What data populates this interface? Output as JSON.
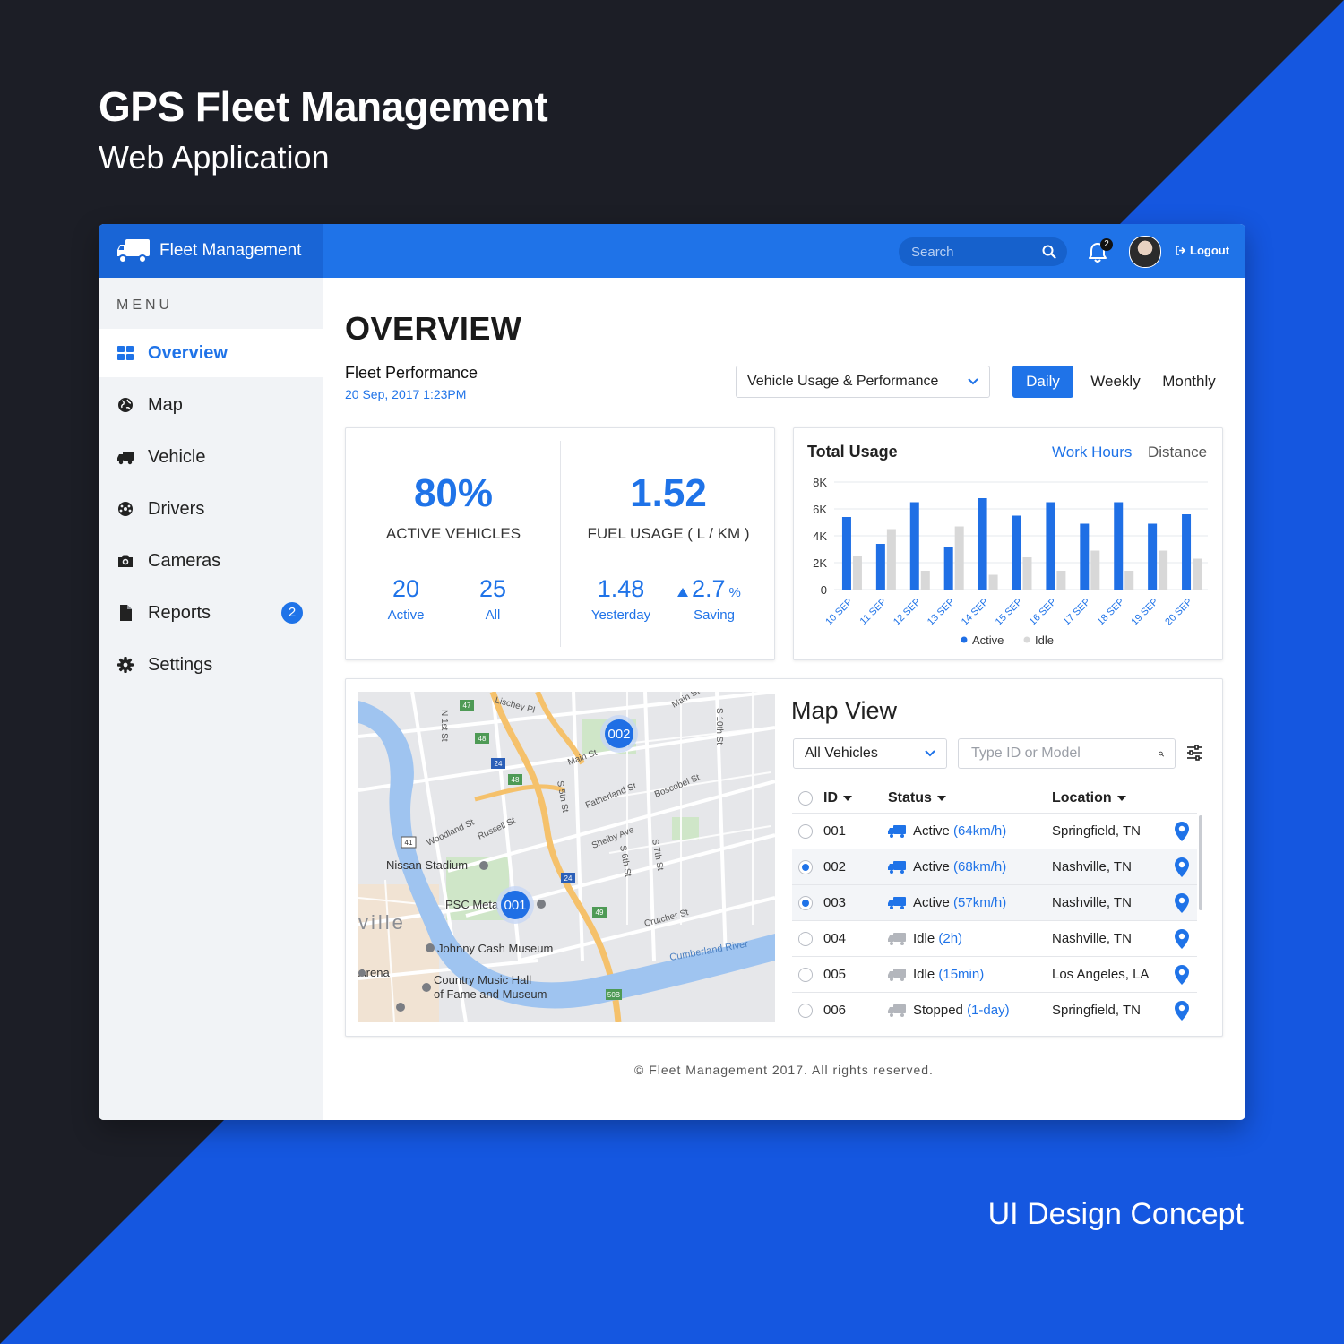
{
  "hero": {
    "title": "GPS Fleet Management",
    "subtitle": "Web Application",
    "tagline": "UI Design Concept"
  },
  "header": {
    "app_name": "Fleet Management",
    "search_placeholder": "Search",
    "notifications_count": "2",
    "logout_label": "Logout"
  },
  "sidebar": {
    "menu_label": "MENU",
    "items": [
      {
        "label": "Overview",
        "icon": "grid-icon",
        "active": true
      },
      {
        "label": "Map",
        "icon": "globe-icon"
      },
      {
        "label": "Vehicle",
        "icon": "truck-icon"
      },
      {
        "label": "Drivers",
        "icon": "steering-wheel-icon"
      },
      {
        "label": "Cameras",
        "icon": "camera-icon"
      },
      {
        "label": "Reports",
        "icon": "document-icon",
        "badge": "2"
      },
      {
        "label": "Settings",
        "icon": "gear-icon"
      }
    ]
  },
  "overview": {
    "title": "OVERVIEW",
    "section_title": "Fleet Performance",
    "section_date": "20 Sep, 2017  1:23PM",
    "dropdown_value": "Vehicle Usage & Performance",
    "periods": [
      "Daily",
      "Weekly",
      "Monthly"
    ],
    "active_period": "Daily"
  },
  "kpis": {
    "active_vehicles": {
      "value": "80%",
      "caption": "ACTIVE VEHICLES",
      "a_value": "20",
      "a_label": "Active",
      "b_value": "25",
      "b_label": "All"
    },
    "fuel_usage": {
      "value": "1.52",
      "caption": "FUEL USAGE ( L / KM )",
      "a_value": "1.48",
      "a_label": "Yesterday",
      "b_value": "2.7",
      "b_unit": "%",
      "b_label": "Saving"
    }
  },
  "usage_chart": {
    "title": "Total Usage",
    "tabs": [
      "Work Hours",
      "Distance"
    ],
    "active_tab": "Work Hours"
  },
  "chart_data": {
    "type": "bar",
    "title": "Total Usage",
    "categories": [
      "10 SEP",
      "11 SEP",
      "12 SEP",
      "13 SEP",
      "14 SEP",
      "15 SEP",
      "16 SEP",
      "17 SEP",
      "18 SEP",
      "19 SEP",
      "20 SEP"
    ],
    "series": [
      {
        "name": "Active",
        "color": "#1f6fe5",
        "values": [
          5400,
          3400,
          6500,
          3200,
          6800,
          5500,
          6500,
          4900,
          6500,
          4900,
          5600
        ]
      },
      {
        "name": "Idle",
        "color": "#d8d8d8",
        "values": [
          2500,
          4500,
          1400,
          4700,
          1100,
          2400,
          1400,
          2900,
          1400,
          2900,
          2300
        ]
      }
    ],
    "yticks": [
      "8K",
      "6K",
      "4K",
      "2K",
      "0"
    ],
    "ylim": [
      0,
      8000
    ],
    "grid": true,
    "legend_position": "bottom"
  },
  "map_view": {
    "title": "Map View",
    "filter_value": "All Vehicles",
    "search_placeholder": "Type ID or Model",
    "columns": [
      "ID",
      "Status",
      "Location"
    ],
    "rows": [
      {
        "id": "001",
        "status": "Active",
        "detail": "(64km/h)",
        "location": "Springfield, TN",
        "selected": false,
        "kind": "active"
      },
      {
        "id": "002",
        "status": "Active",
        "detail": "(68km/h)",
        "location": "Nashville, TN",
        "selected": true,
        "kind": "active"
      },
      {
        "id": "003",
        "status": "Active",
        "detail": "(57km/h)",
        "location": "Nashville, TN",
        "selected": true,
        "kind": "active"
      },
      {
        "id": "004",
        "status": "Idle",
        "detail": "(2h)",
        "location": "Nashville, TN",
        "selected": false,
        "kind": "idle"
      },
      {
        "id": "005",
        "status": "Idle",
        "detail": "(15min)",
        "location": "Los Angeles, LA",
        "selected": false,
        "kind": "idle"
      },
      {
        "id": "006",
        "status": "Stopped",
        "detail": "(1-day)",
        "location": "Springfield, TN",
        "selected": false,
        "kind": "idle"
      }
    ],
    "map_labels": {
      "marker_a": "002",
      "marker_b": "001",
      "stadium": "Nissan Stadium",
      "psc": "PSC Meta",
      "museum": "Johnny Cash Museum",
      "hall_1": "Country Music Hall",
      "hall_2": "of Fame and Museum",
      "river": "Cumberland River",
      "city": "ville",
      "arena": "Arena",
      "st_1": "Woodland St",
      "st_2": "Main St",
      "st_3": "Russell St",
      "st_4": "Shelby Ave",
      "st_5": "Fatherland St",
      "st_6": "Boscobel St",
      "st_7": "Crutcher St",
      "st_8": "S 5th St",
      "st_9": "N 1st St",
      "st_10": "Lischey Pl",
      "st_11": "S 7th St",
      "st_12": "S 6th St",
      "st_13": "S 10th St",
      "st_14": "Main St",
      "hw_1": "24",
      "hw_2": "48",
      "hw_3": "47",
      "hw_4": "49",
      "hw_5": "41",
      "hw_6": "50B"
    }
  },
  "footer": {
    "text": "©  Fleet Management 2017. All rights reserved."
  }
}
